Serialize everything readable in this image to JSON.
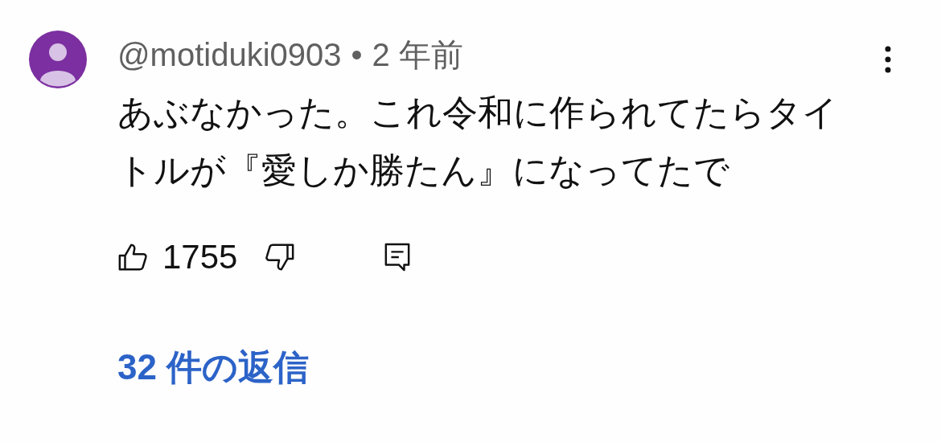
{
  "comment": {
    "author": "@motiduki0903",
    "separator": "•",
    "time": "2 年前",
    "text": "あぶなかった。これ令和に作られてたらタイトルが『愛しか勝たん』になってたで",
    "likes": "1755",
    "replies": "32 件の返信"
  }
}
